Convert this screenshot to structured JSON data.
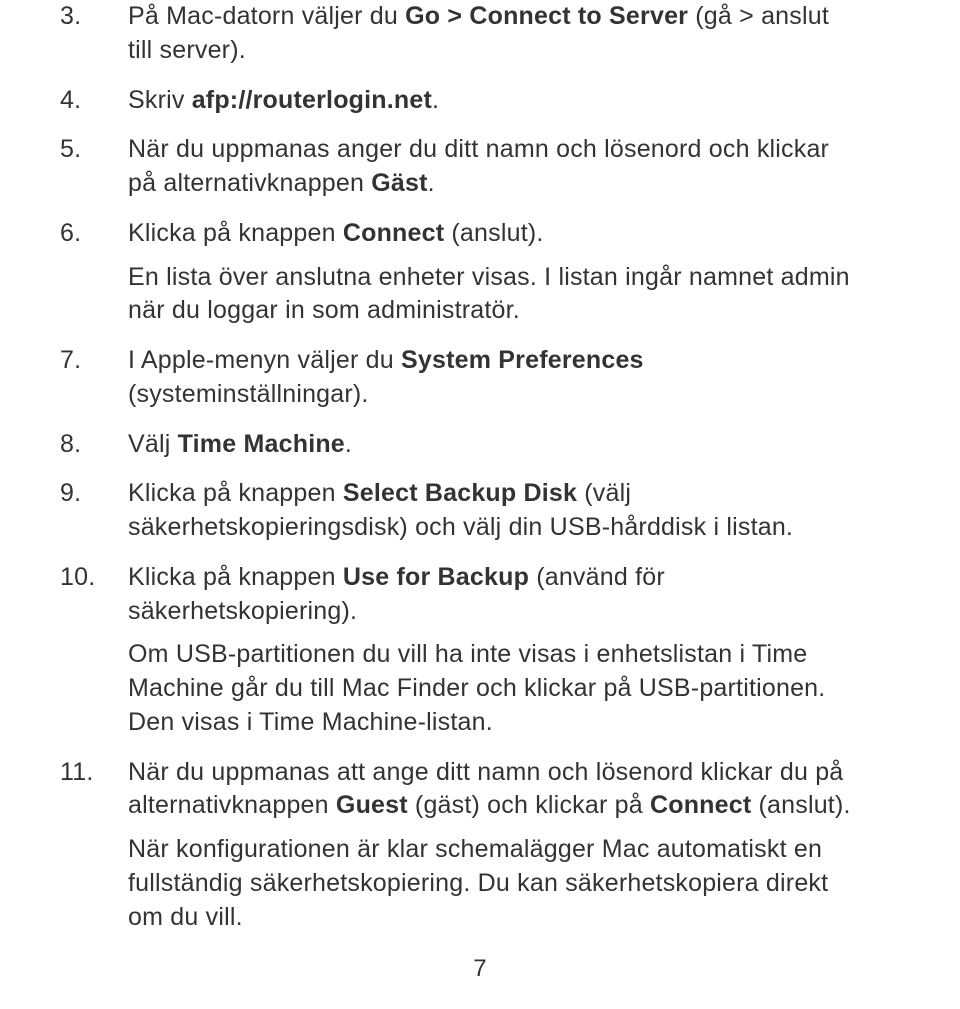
{
  "steps": [
    {
      "n": "3.",
      "paras": [
        {
          "segments": [
            {
              "t": "På Mac-datorn väljer du "
            },
            {
              "t": "Go > Connect to Server",
              "b": true
            },
            {
              "t": " (gå > anslut till server)."
            }
          ]
        }
      ]
    },
    {
      "n": "4.",
      "paras": [
        {
          "segments": [
            {
              "t": "Skriv "
            },
            {
              "t": "afp://routerlogin.net",
              "b": true
            },
            {
              "t": "."
            }
          ]
        }
      ]
    },
    {
      "n": "5.",
      "paras": [
        {
          "segments": [
            {
              "t": "När du uppmanas anger du ditt namn och lösenord och klickar på alternativknappen "
            },
            {
              "t": "Gäst",
              "b": true
            },
            {
              "t": "."
            }
          ]
        }
      ]
    },
    {
      "n": "6.",
      "paras": [
        {
          "segments": [
            {
              "t": "Klicka på knappen "
            },
            {
              "t": "Connect",
              "b": true
            },
            {
              "t": " (anslut)."
            }
          ]
        },
        {
          "segments": [
            {
              "t": "En lista över anslutna enheter visas. I listan ingår namnet admin när du loggar in som administratör."
            }
          ]
        }
      ]
    },
    {
      "n": "7.",
      "paras": [
        {
          "segments": [
            {
              "t": "I Apple-menyn väljer du "
            },
            {
              "t": "System Preferences",
              "b": true
            },
            {
              "t": " (systeminställningar)."
            }
          ]
        }
      ]
    },
    {
      "n": "8.",
      "paras": [
        {
          "segments": [
            {
              "t": "Välj "
            },
            {
              "t": "Time Machine",
              "b": true
            },
            {
              "t": "."
            }
          ]
        }
      ]
    },
    {
      "n": "9.",
      "paras": [
        {
          "segments": [
            {
              "t": "Klicka på knappen "
            },
            {
              "t": "Select Backup Disk",
              "b": true
            },
            {
              "t": " (välj säkerhetskopieringsdisk) och välj din USB-hårddisk i listan."
            }
          ]
        }
      ]
    },
    {
      "n": "10.",
      "paras": [
        {
          "segments": [
            {
              "t": "Klicka på knappen "
            },
            {
              "t": "Use for Backup",
              "b": true
            },
            {
              "t": " (använd för säkerhetskopiering)."
            }
          ]
        },
        {
          "segments": [
            {
              "t": "Om USB-partitionen du vill ha inte visas i enhetslistan i Time Machine går du till Mac Finder och klickar på USB-partitionen. Den visas i Time Machine-listan."
            }
          ]
        }
      ]
    },
    {
      "n": "11.",
      "paras": [
        {
          "segments": [
            {
              "t": "När du uppmanas att ange ditt namn och lösenord klickar du på alternativknappen "
            },
            {
              "t": "Guest",
              "b": true
            },
            {
              "t": " (gäst) och klickar på "
            },
            {
              "t": "Connect",
              "b": true
            },
            {
              "t": " (anslut)."
            }
          ]
        },
        {
          "segments": [
            {
              "t": "När konfigurationen är klar schemalägger Mac automatiskt en fullständig säkerhetskopiering. Du kan säkerhetskopiera direkt om du vill."
            }
          ]
        }
      ]
    }
  ],
  "page_number": "7"
}
